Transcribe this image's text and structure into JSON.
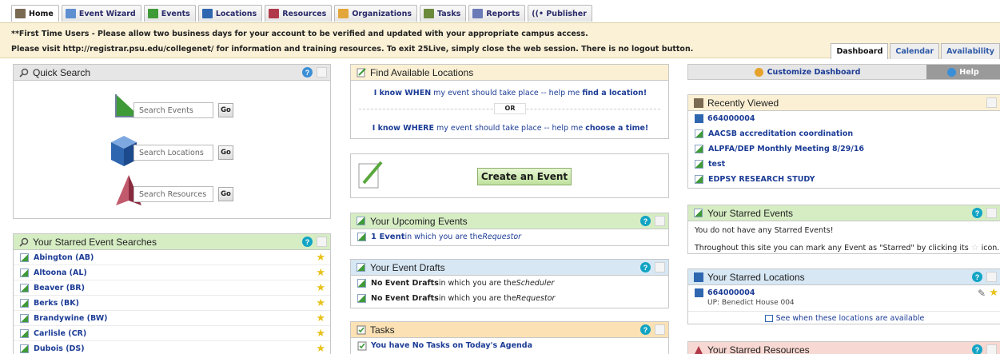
{
  "nav": {
    "tabs": [
      {
        "label": "Home",
        "icon": "home-icon",
        "color": "#7a6a52"
      },
      {
        "label": "Event Wizard",
        "icon": "wizard-icon",
        "color": "#5e8fd0"
      },
      {
        "label": "Events",
        "icon": "event-icon",
        "color": "#3f9a38"
      },
      {
        "label": "Locations",
        "icon": "location-icon",
        "color": "#2f66b0"
      },
      {
        "label": "Resources",
        "icon": "resource-icon",
        "color": "#b03a4a"
      },
      {
        "label": "Organizations",
        "icon": "organization-icon",
        "color": "#e2a63a"
      },
      {
        "label": "Tasks",
        "icon": "task-icon",
        "color": "#6c8a3c"
      },
      {
        "label": "Reports",
        "icon": "report-icon",
        "color": "#6b7bb8"
      },
      {
        "label": "((• Publisher",
        "icon": "publisher-icon",
        "color": "#2f5aa8"
      }
    ]
  },
  "banner": {
    "line1": "**First Time Users - Please allow two business days for your account to be verified and updated with your appropriate campus access.",
    "line2": "Please visit http://registrar.psu.edu/collegenet/ for information and training resources. To exit 25Live, simply close the web session. There is no logout button."
  },
  "view_tabs": [
    "Dashboard",
    "Calendar",
    "Availability"
  ],
  "quick_search": {
    "title": "Quick Search",
    "events_placeholder": "Search Events",
    "locations_placeholder": "Search Locations",
    "resources_placeholder": "Search Resources",
    "go": "Go"
  },
  "starred_searches": {
    "title": "Your Starred Event Searches",
    "items": [
      "Abington (AB)",
      "Altoona (AL)",
      "Beaver (BR)",
      "Berks (BK)",
      "Brandywine (BW)",
      "Carlisle (CR)",
      "Dubois (DS)"
    ]
  },
  "find_locations": {
    "title": "Find Available Locations",
    "when_a": "I know WHEN",
    "when_b": " my event should take place -- help me ",
    "when_c": "find a location!",
    "or": "OR",
    "where_a": "I know WHERE",
    "where_b": " my event should take place -- help me ",
    "where_c": "choose a time!"
  },
  "create_event": {
    "label": "Create an Event"
  },
  "upcoming": {
    "title": "Your Upcoming Events",
    "count": "1 Event",
    "text": " in which you are the ",
    "role": "Requestor"
  },
  "drafts": {
    "title": "Your Event Drafts",
    "rows": [
      {
        "bold": "No Event Drafts",
        "text": " in which you are the ",
        "role": "Scheduler"
      },
      {
        "bold": "No Event Drafts",
        "text": " in which you are the ",
        "role": "Requestor"
      }
    ]
  },
  "tasks": {
    "title": "Tasks",
    "item": "You have No Tasks on Today's Agenda"
  },
  "customize": {
    "label": "Customize Dashboard",
    "help": "Help"
  },
  "recent": {
    "title": "Recently Viewed",
    "items": [
      "664000004",
      "AACSB accreditation coordination",
      "ALPFA/DEP Monthly Meeting 8/29/16",
      "test",
      "EDPSY RESEARCH STUDY"
    ]
  },
  "starred_events": {
    "title": "Your Starred Events",
    "line1": "You do not have any Starred Events!",
    "line2a": "Throughout this site you can mark any Event as \"Starred\" by clicking its",
    "line2b": "icon."
  },
  "starred_locations": {
    "title": "Your Starred Locations",
    "item": "664000004",
    "sub": "UP: Benedict House 004",
    "see": "See when these locations are available"
  },
  "starred_resources": {
    "title": "Your Starred Resources"
  }
}
